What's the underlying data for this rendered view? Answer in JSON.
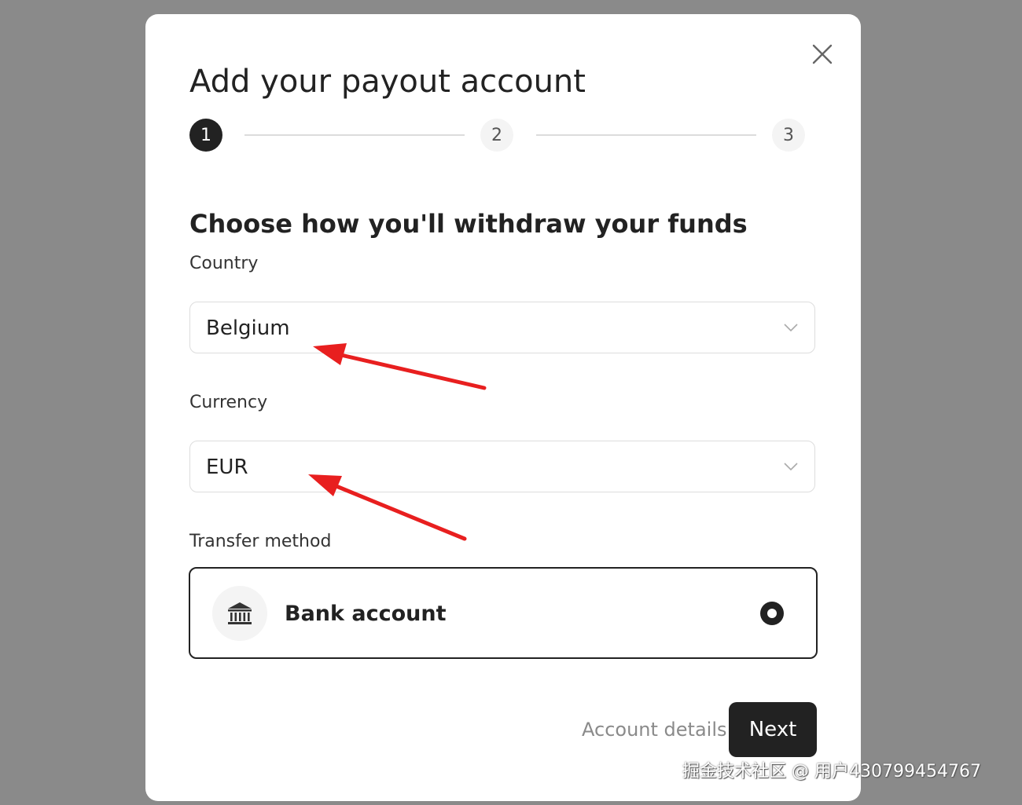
{
  "modal": {
    "title": "Add your payout account",
    "close_icon": "close-icon",
    "steps": [
      {
        "number": "1",
        "state": "active"
      },
      {
        "number": "2",
        "state": "inactive"
      },
      {
        "number": "3",
        "state": "inactive"
      }
    ]
  },
  "form": {
    "section_title": "Choose how you'll withdraw your funds",
    "country": {
      "label": "Country",
      "value": "Belgium",
      "icon": "chevron-down-icon"
    },
    "currency": {
      "label": "Currency",
      "value": "EUR",
      "icon": "chevron-down-icon"
    },
    "transfer_method": {
      "label": "Transfer method",
      "option_label": "Bank account",
      "option_icon": "bank-icon",
      "selected": true
    }
  },
  "footer": {
    "link_label": "Account details",
    "next_label": "Next"
  },
  "annotations": {
    "arrow_color": "#e81f1f"
  },
  "watermark": {
    "text": "掘金技术社区 @ 用户430799454767"
  },
  "colors": {
    "backdrop": "#8a8a8a",
    "primary": "#222222",
    "muted": "#8a8a8a",
    "border": "#dddddd"
  }
}
